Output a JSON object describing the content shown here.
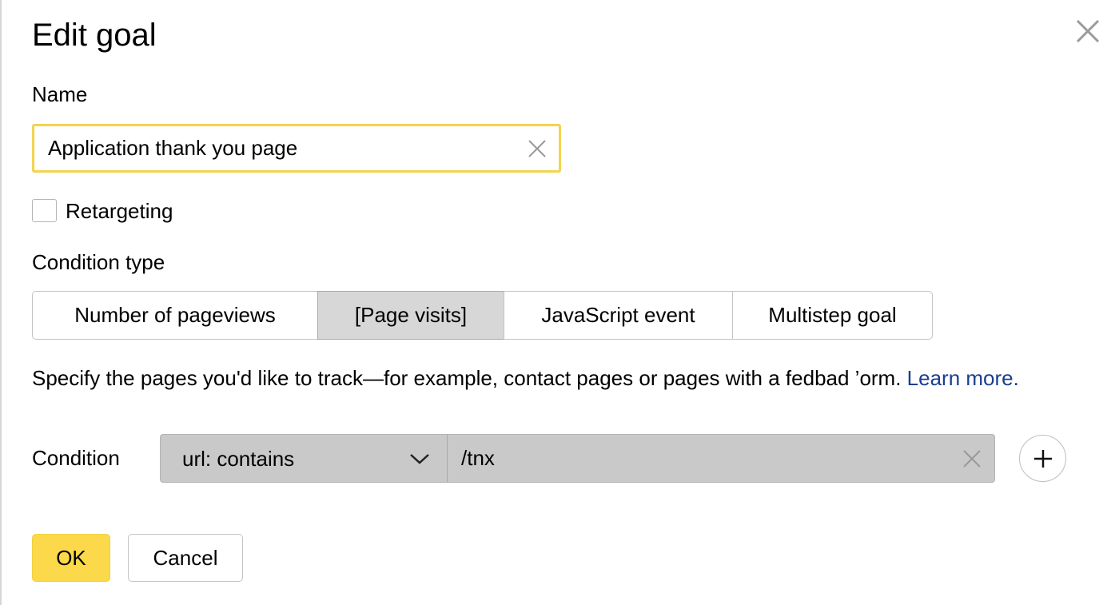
{
  "dialog": {
    "title": "Edit goal",
    "close_icon": "close-icon"
  },
  "name_field": {
    "label": "Name",
    "value": "Application thank you page",
    "clear_icon": "clear-icon"
  },
  "retargeting": {
    "label": "Retargeting",
    "checked": false
  },
  "condition_type": {
    "label": "Condition type",
    "options": [
      "Number of pageviews",
      "[Page visits]",
      "JavaScript event",
      "Multistep goal"
    ],
    "selected": "[Page visits]"
  },
  "description": {
    "text": "Specify the pages you'd like to track—for example, contact pages or pages with a fedbad ’orm. ",
    "link": "Learn more."
  },
  "condition": {
    "label": "Condition",
    "operator": "url: contains",
    "value": "/tnx",
    "clear_icon": "clear-icon",
    "add_icon": "plus-icon"
  },
  "buttons": {
    "ok": "OK",
    "cancel": "Cancel"
  },
  "colors": {
    "accent": "#fcd94a",
    "focus_border": "#f2d44e",
    "link": "#1a3d8f",
    "selected_segment": "#d7d7d7"
  }
}
